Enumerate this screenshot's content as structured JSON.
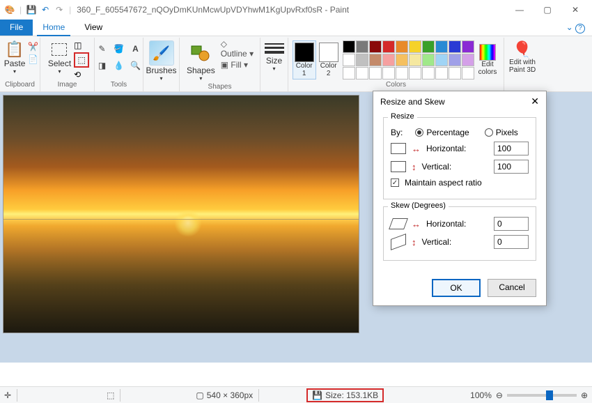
{
  "title": "360_F_605547672_nQOyDmKUnMcwUpVDYhwM1KgUpvRxf0sR - Paint",
  "menus": {
    "file": "File",
    "home": "Home",
    "view": "View"
  },
  "ribbon": {
    "clipboard": {
      "paste": "Paste",
      "label": "Clipboard"
    },
    "image": {
      "select": "Select",
      "label": "Image"
    },
    "tools": {
      "label": "Tools"
    },
    "brushes": {
      "label": "Brushes",
      "btn": "Brushes"
    },
    "shapes": {
      "btn": "Shapes",
      "outline": "Outline",
      "fill": "Fill",
      "label": "Shapes"
    },
    "size": {
      "btn": "Size"
    },
    "colors": {
      "c1": "Color\n1",
      "c2": "Color\n2",
      "edit": "Edit\ncolors",
      "paint3d": "Edit with\nPaint 3D",
      "label": "Colors"
    }
  },
  "palette_colors": [
    "#000",
    "#7a7a7a",
    "#8a0a0a",
    "#d42a2a",
    "#e88a2a",
    "#f5d22a",
    "#3aa02a",
    "#2a8ad4",
    "#2a3ad4",
    "#8a2ad4",
    "#fff",
    "#c0c0c0",
    "#c48a6a",
    "#f5a0a0",
    "#f5c060",
    "#f5e8a0",
    "#a0e88a",
    "#a0d4f5",
    "#a0a0e8",
    "#d4a0e8",
    "#fff",
    "#fff",
    "#fff",
    "#fff",
    "#fff",
    "#fff",
    "#fff",
    "#fff",
    "#fff",
    "#fff"
  ],
  "rainbow": "linear-gradient(90deg,#f00,#ff0,#0f0,#0ff,#00f,#f0f)",
  "dialog": {
    "title": "Resize and Skew",
    "resize": {
      "legend": "Resize",
      "by": "By:",
      "percentage": "Percentage",
      "pixels": "Pixels",
      "horizontal": "Horizontal:",
      "vertical": "Vertical:",
      "h_val": "100",
      "v_val": "100",
      "maintain": "Maintain aspect ratio"
    },
    "skew": {
      "legend": "Skew (Degrees)",
      "horizontal": "Horizontal:",
      "vertical": "Vertical:",
      "h_val": "0",
      "v_val": "0"
    },
    "ok": "OK",
    "cancel": "Cancel"
  },
  "status": {
    "dim": "540 × 360px",
    "size": "Size: 153.1KB",
    "zoom": "100%"
  }
}
